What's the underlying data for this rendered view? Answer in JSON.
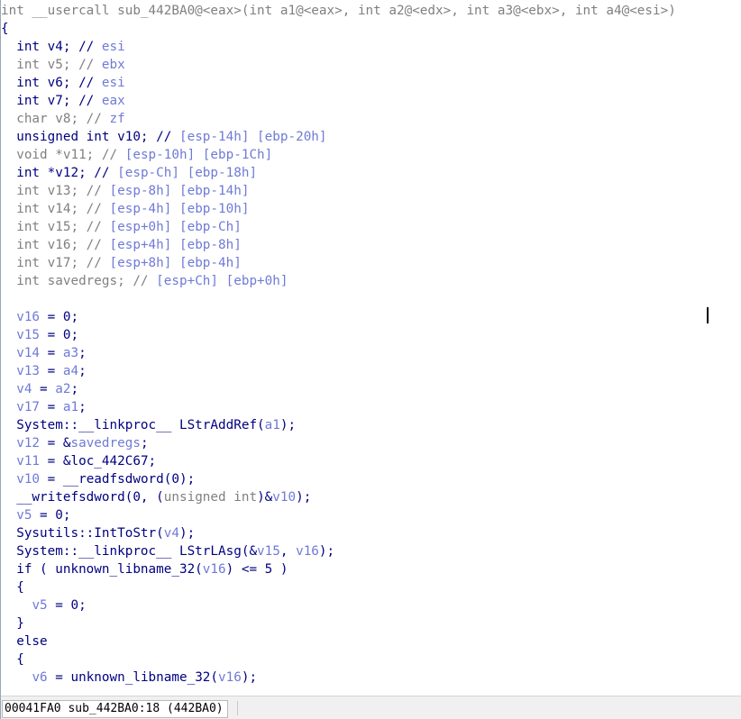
{
  "signature": "int __usercall sub_442BA0@<eax>(int a1@<eax>, int a2@<edx>, int a3@<ebx>, int a4@<esi>)",
  "lines": [
    [
      [
        "int __usercall sub_442BA0@<eax>(int a1@<eax>, int a2@<edx>, int a3@<ebx>, int a4@<esi>)",
        "g"
      ]
    ],
    [
      [
        "{",
        "n"
      ]
    ],
    [
      [
        "  int v4; // ",
        "n"
      ],
      [
        "esi",
        "v"
      ]
    ],
    [
      [
        "  int v5; // ",
        "g"
      ],
      [
        "ebx",
        "v"
      ]
    ],
    [
      [
        "  int v6; // ",
        "n"
      ],
      [
        "esi",
        "v"
      ]
    ],
    [
      [
        "  int v7; // ",
        "n"
      ],
      [
        "eax",
        "v"
      ]
    ],
    [
      [
        "  char v8; // ",
        "g"
      ],
      [
        "zf",
        "v"
      ]
    ],
    [
      [
        "  unsigned int v10; // ",
        "n"
      ],
      [
        "[esp-14h] [ebp-20h]",
        "v"
      ]
    ],
    [
      [
        "  void *v11; // ",
        "g"
      ],
      [
        "[esp-10h] [ebp-1Ch]",
        "v"
      ]
    ],
    [
      [
        "  int *v12; // ",
        "n"
      ],
      [
        "[esp-Ch] [ebp-18h]",
        "v"
      ]
    ],
    [
      [
        "  int v13; // ",
        "g"
      ],
      [
        "[esp-8h] [ebp-14h]",
        "v"
      ]
    ],
    [
      [
        "  int v14; // ",
        "g"
      ],
      [
        "[esp-4h] [ebp-10h]",
        "v"
      ]
    ],
    [
      [
        "  int v15; // ",
        "g"
      ],
      [
        "[esp+0h] [ebp-Ch]",
        "v"
      ]
    ],
    [
      [
        "  int v16; // ",
        "g"
      ],
      [
        "[esp+4h] [ebp-8h]",
        "v"
      ]
    ],
    [
      [
        "  int v17; // ",
        "g"
      ],
      [
        "[esp+8h] [ebp-4h]",
        "v"
      ]
    ],
    [
      [
        "  int savedregs; // ",
        "g"
      ],
      [
        "[esp+Ch] [ebp+0h]",
        "v"
      ]
    ],
    [
      [
        "",
        "n"
      ]
    ],
    [
      [
        "  ",
        "n"
      ],
      [
        "v16",
        "v"
      ],
      [
        " = 0;",
        "n"
      ]
    ],
    [
      [
        "  ",
        "n"
      ],
      [
        "v15",
        "v"
      ],
      [
        " = 0;",
        "n"
      ]
    ],
    [
      [
        "  ",
        "n"
      ],
      [
        "v14",
        "v"
      ],
      [
        " = ",
        "n"
      ],
      [
        "a3",
        "v"
      ],
      [
        ";",
        "n"
      ]
    ],
    [
      [
        "  ",
        "n"
      ],
      [
        "v13",
        "v"
      ],
      [
        " = ",
        "n"
      ],
      [
        "a4",
        "v"
      ],
      [
        ";",
        "n"
      ]
    ],
    [
      [
        "  ",
        "n"
      ],
      [
        "v4",
        "v"
      ],
      [
        " = ",
        "n"
      ],
      [
        "a2",
        "v"
      ],
      [
        ";",
        "n"
      ]
    ],
    [
      [
        "  ",
        "n"
      ],
      [
        "v17",
        "v"
      ],
      [
        " = ",
        "n"
      ],
      [
        "a1",
        "v"
      ],
      [
        ";",
        "n"
      ]
    ],
    [
      [
        "  System::__linkproc__ LStrAddRef(",
        "n"
      ],
      [
        "a1",
        "v"
      ],
      [
        ");",
        "n"
      ]
    ],
    [
      [
        "  ",
        "n"
      ],
      [
        "v12",
        "v"
      ],
      [
        " = &",
        "n"
      ],
      [
        "savedregs",
        "v"
      ],
      [
        ";",
        "n"
      ]
    ],
    [
      [
        "  ",
        "n"
      ],
      [
        "v11",
        "v"
      ],
      [
        " = &loc_442C67;",
        "n"
      ]
    ],
    [
      [
        "  ",
        "n"
      ],
      [
        "v10",
        "v"
      ],
      [
        " = __readfsdword(0);",
        "n"
      ]
    ],
    [
      [
        "  __writefsdword(0, (",
        "n"
      ],
      [
        "unsigned int",
        "g"
      ],
      [
        ")&",
        "n"
      ],
      [
        "v10",
        "v"
      ],
      [
        ");",
        "n"
      ]
    ],
    [
      [
        "  ",
        "n"
      ],
      [
        "v5",
        "v"
      ],
      [
        " = 0;",
        "n"
      ]
    ],
    [
      [
        "  Sysutils::IntToStr(",
        "n"
      ],
      [
        "v4",
        "v"
      ],
      [
        ");",
        "n"
      ]
    ],
    [
      [
        "  System::__linkproc__ LStrLAsg(&",
        "n"
      ],
      [
        "v15",
        "v"
      ],
      [
        ", ",
        "n"
      ],
      [
        "v16",
        "v"
      ],
      [
        ");",
        "n"
      ]
    ],
    [
      [
        "  if ( unknown_libname_32(",
        "n"
      ],
      [
        "v16",
        "v"
      ],
      [
        ") <= 5 )",
        "n"
      ]
    ],
    [
      [
        "  {",
        "n"
      ]
    ],
    [
      [
        "    ",
        "n"
      ],
      [
        "v5",
        "v"
      ],
      [
        " = 0;",
        "n"
      ]
    ],
    [
      [
        "  }",
        "n"
      ]
    ],
    [
      [
        "  else",
        "n"
      ]
    ],
    [
      [
        "  {",
        "n"
      ]
    ],
    [
      [
        "    ",
        "n"
      ],
      [
        "v6",
        "v"
      ],
      [
        " = unknown_libname_32(",
        "n"
      ],
      [
        "v16",
        "v"
      ],
      [
        ");",
        "n"
      ]
    ]
  ],
  "statusbar": {
    "text": "00041FA0 sub_442BA0:18 (442BA0)"
  }
}
